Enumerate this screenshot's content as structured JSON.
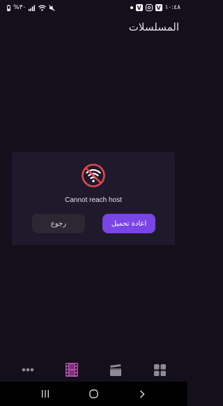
{
  "status_bar": {
    "time": "١٠:٤٨",
    "battery": "%٣٠",
    "apps": [
      "v-app-icon",
      "instagram-icon",
      "v-app-icon"
    ]
  },
  "header": {
    "title": "المسلسلات"
  },
  "error": {
    "message": "Cannot reach host",
    "icon": "wifi-off-icon",
    "reload_label": "اعادة تحميل",
    "back_label": "رجوع"
  },
  "bottom_nav": {
    "items": [
      "more-icon",
      "film-strip-icon",
      "clapperboard-icon",
      "grid-icon"
    ],
    "active": "film-strip-icon"
  },
  "colors": {
    "background": "#130f1b",
    "card": "#1f192c",
    "accent": "#7a45e6",
    "error_red": "#e4474e",
    "active_nav": "#b04fa8"
  }
}
